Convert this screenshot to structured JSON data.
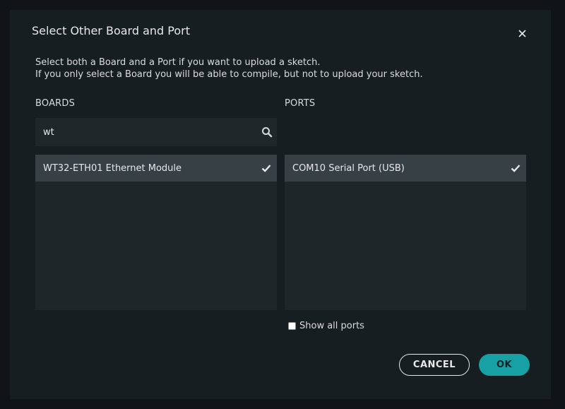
{
  "dialog": {
    "title": "Select Other Board and Port",
    "description": [
      "Select both a Board and a Port if you want to upload a sketch.",
      "If you only select a Board you will be able to compile, but not to upload your sketch."
    ]
  },
  "boards": {
    "label": "BOARDS",
    "search_value": "wt",
    "items": [
      {
        "label": "WT32-ETH01 Ethernet Module",
        "selected": true
      }
    ]
  },
  "ports": {
    "label": "PORTS",
    "items": [
      {
        "label": "COM10 Serial Port (USB)",
        "selected": true
      }
    ],
    "show_all_label": "Show all ports",
    "show_all_checked": false
  },
  "buttons": {
    "cancel": "CANCEL",
    "ok": "OK"
  },
  "colors": {
    "accent": "#17a1a5",
    "dialog_bg": "#171e21",
    "selected_item": "#374045"
  },
  "icons": {
    "close": "close-icon",
    "search": "search-icon",
    "check": "check-icon"
  }
}
